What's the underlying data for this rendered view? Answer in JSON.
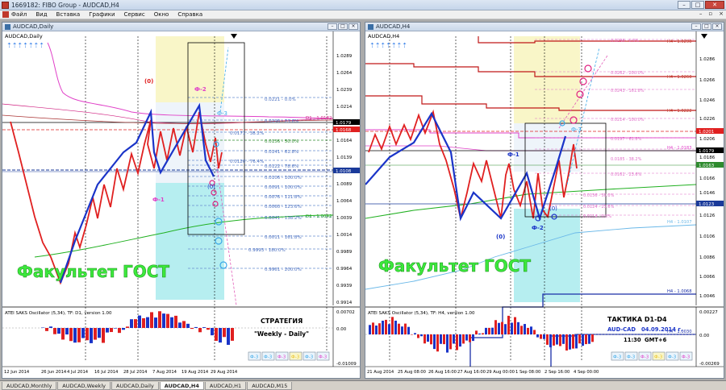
{
  "app": {
    "title": "1669182: FIBO Group - AUDCAD,H4"
  },
  "menu": [
    "Файл",
    "Вид",
    "Вставка",
    "Графики",
    "Сервис",
    "Окно",
    "Справка"
  ],
  "left_window": {
    "title": "AUDCAD,Daily",
    "chart_label": "AUDCAD,Daily",
    "price_ticks": [
      "1.0289",
      "1.0264",
      "1.0239",
      "1.0214",
      "1.0189",
      "1.0164",
      "1.0139",
      "1.0114",
      "1.0089",
      "1.0064",
      "1.0039",
      "1.0014",
      "0.9989",
      "0.9964",
      "0.9939",
      "0.9914"
    ],
    "price_badges": [
      {
        "text": "1.0179",
        "color": "#000000"
      },
      {
        "text": "1.0168",
        "color": "#E02020"
      },
      {
        "text": "1.0108",
        "color": "#1A3A9A"
      }
    ],
    "fibo_labels": [
      "0.0221 - 0.0%",
      "0.0190 - 23.6%",
      "0.0171 - 38.2%",
      "0.0156 - 50.0%",
      "0.0141 - 61.8%",
      "0.0126 - 76.4%",
      "0.0122 - 78.6%",
      "0.0106 - 100.0%",
      "0.0091 - 100.0%",
      "0.0076 - 111.8%",
      "0.0060 - 123.6%",
      "0.0041 - 138.2%",
      "0.0011 - 161.8%",
      "0.9993 - 180.0%",
      "0.9961 - 200.0%"
    ],
    "d1_labels": [
      "D1 - 1.0182",
      "D1 - 1.0042"
    ],
    "wave_labels": {
      "zero": "(0)",
      "f2": "Ф-2",
      "f3": "Ф-3",
      "f1": "Ф-1",
      "o": "(0)"
    },
    "watermark": "Факультет ГОСТ",
    "oscillator_label": "ATEI SAKS Oscillator (5,34), TF: D1, version 1.00",
    "osc_ticks": [
      "0.00702",
      "0.00",
      "-0.01009"
    ],
    "strategy_title": "СТРАТЕГИЯ",
    "strategy_sub": "\"Weekly - Daily\"",
    "time_ticks": [
      "12 Jun 2014",
      "26 Jun 2014",
      "4 Jul 2014",
      "16 Jul 2014",
      "28 Jul 2014",
      "7 Aug 2014",
      "19 Aug 2014",
      "29 Aug 2014"
    ],
    "f_buttons": [
      "Ф-3",
      "Ф-3",
      "Ф-3",
      "Ф-3",
      "Ф-3",
      "Ф-3"
    ]
  },
  "right_window": {
    "title": "AUDCAD,H4",
    "chart_label": "AUDCAD,H4",
    "price_ticks": [
      "1.0286",
      "1.0266",
      "1.0246",
      "1.0226",
      "1.0206",
      "1.0186",
      "1.0166",
      "1.0146",
      "1.0126",
      "1.0106",
      "1.0086",
      "1.0066",
      "1.0046",
      "1.0026"
    ],
    "price_badges": [
      {
        "text": "1.0201",
        "color": "#E02020"
      },
      {
        "text": "1.0179",
        "color": "#000000"
      },
      {
        "text": "1.0163",
        "color": "#2E8B2E"
      },
      {
        "text": "1.0123",
        "color": "#1A3A9A"
      }
    ],
    "h4_labels": [
      "H4 - 1.0298",
      "H4 - 1.0260",
      "H4 - 1.0222",
      "H4 - 1.0183",
      "H4 - 1.0107",
      "H4 - 1.0068",
      "H4 - 1.0030"
    ],
    "fibo_labels": [
      "0.0298 - 0.0%",
      "0.0262 - 200.0%",
      "0.0243 - 161.8%",
      "0.0214 - 100.0%",
      "0.0197 - 61.8%",
      "0.0185 - 38.2%",
      "0.0161 - 23.6%",
      "0.0136 - 50.0%",
      "0.0124 - 23.6%",
      "0.0114 - 0.0%"
    ],
    "wave_labels": {
      "f1": "Ф-1",
      "f2": "Ф-2",
      "f3": "Ф-3",
      "zero": "(0)",
      "zero2": "(0)"
    },
    "watermark": "Факультет ГОСТ",
    "oscillator_label": "ATEI SAKS Oscillator (5,34), TF: H4, version 1.00",
    "osc_ticks": [
      "0.00227",
      "0.00",
      "-0.00269"
    ],
    "tactic_title": "ТАКТИКА  D1-D4",
    "tactic_pair": "AUD-CAD",
    "tactic_date": "04.09.2014 г.",
    "tactic_time": "11:30",
    "tactic_tz": "GMT+6",
    "time_ticks": [
      "21 Aug 2014",
      "25 Aug 08:00",
      "26 Aug 16:00",
      "27 Aug 16:00",
      "29 Aug 00:00",
      "1 Sep 08:00",
      "2 Sep 16:00",
      "4 Sep 00:00"
    ],
    "f_buttons": [
      "Ф-3",
      "Ф-3",
      "Ф-3",
      "Ф-3",
      "Ф-3",
      "Ф-3"
    ]
  },
  "tabs": [
    "AUDCAD,Monthly",
    "AUDCAD,Weekly",
    "AUDCAD,Daily",
    "AUDCAD,H4",
    "AUDCAD,H1",
    "AUDCAD,M15"
  ],
  "active_tab": "AUDCAD,H4"
}
